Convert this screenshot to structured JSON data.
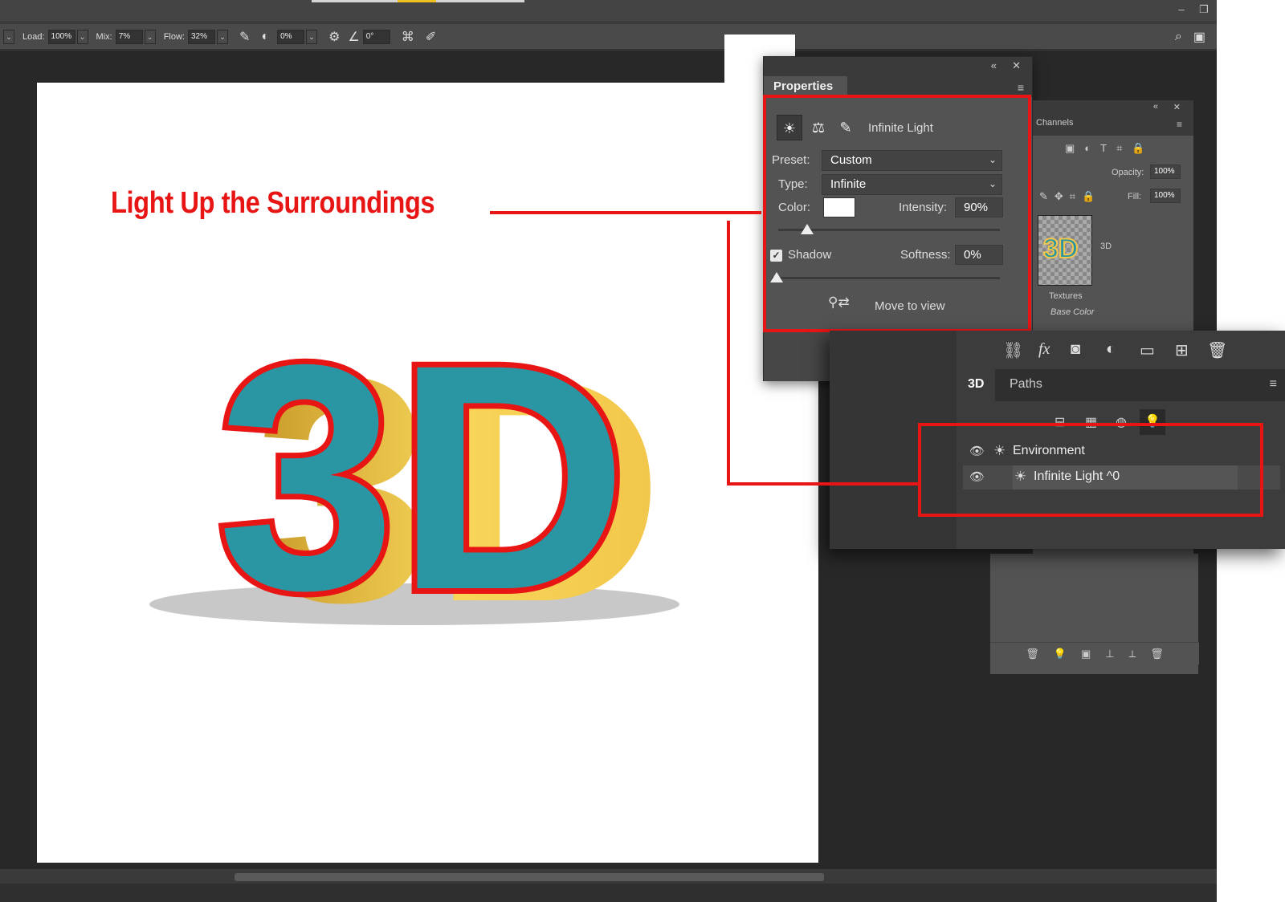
{
  "toolbar": {
    "load_label": "Load:",
    "load_value": "100%",
    "mix_label": "Mix:",
    "mix_value": "7%",
    "flow_label": "Flow:",
    "flow_value": "32%",
    "smoothing_value": "0%",
    "angle_value": "0°"
  },
  "headline": "Light Up the Surroundings",
  "artwork_text": "3D",
  "properties": {
    "tab_label": "Properties",
    "light_name": "Infinite Light",
    "preset_label": "Preset:",
    "preset_value": "Custom",
    "type_label": "Type:",
    "type_value": "Infinite",
    "color_label": "Color:",
    "intensity_label": "Intensity:",
    "intensity_value": "90%",
    "intensity_level": 0.12,
    "shadow_label": "Shadow",
    "shadow_checked": true,
    "softness_label": "Softness:",
    "softness_value": "0%",
    "move_to_view_label": "Move to view"
  },
  "channels_panel": {
    "tab_label": "Channels",
    "opacity_label": "Opacity:",
    "opacity_value": "100%",
    "fill_label": "Fill:",
    "fill_value": "100%",
    "layer_name": "3D",
    "textures_label": "Textures",
    "base_color_label": "Base Color"
  },
  "panel3d": {
    "tab_3d": "3D",
    "tab_paths": "Paths",
    "items": [
      {
        "label": "Environment"
      },
      {
        "label": "Infinite Light ^0"
      }
    ]
  },
  "colors": {
    "accent_red": "#e81515",
    "teal": "#2a96a4",
    "gold": "#f2c64a"
  }
}
